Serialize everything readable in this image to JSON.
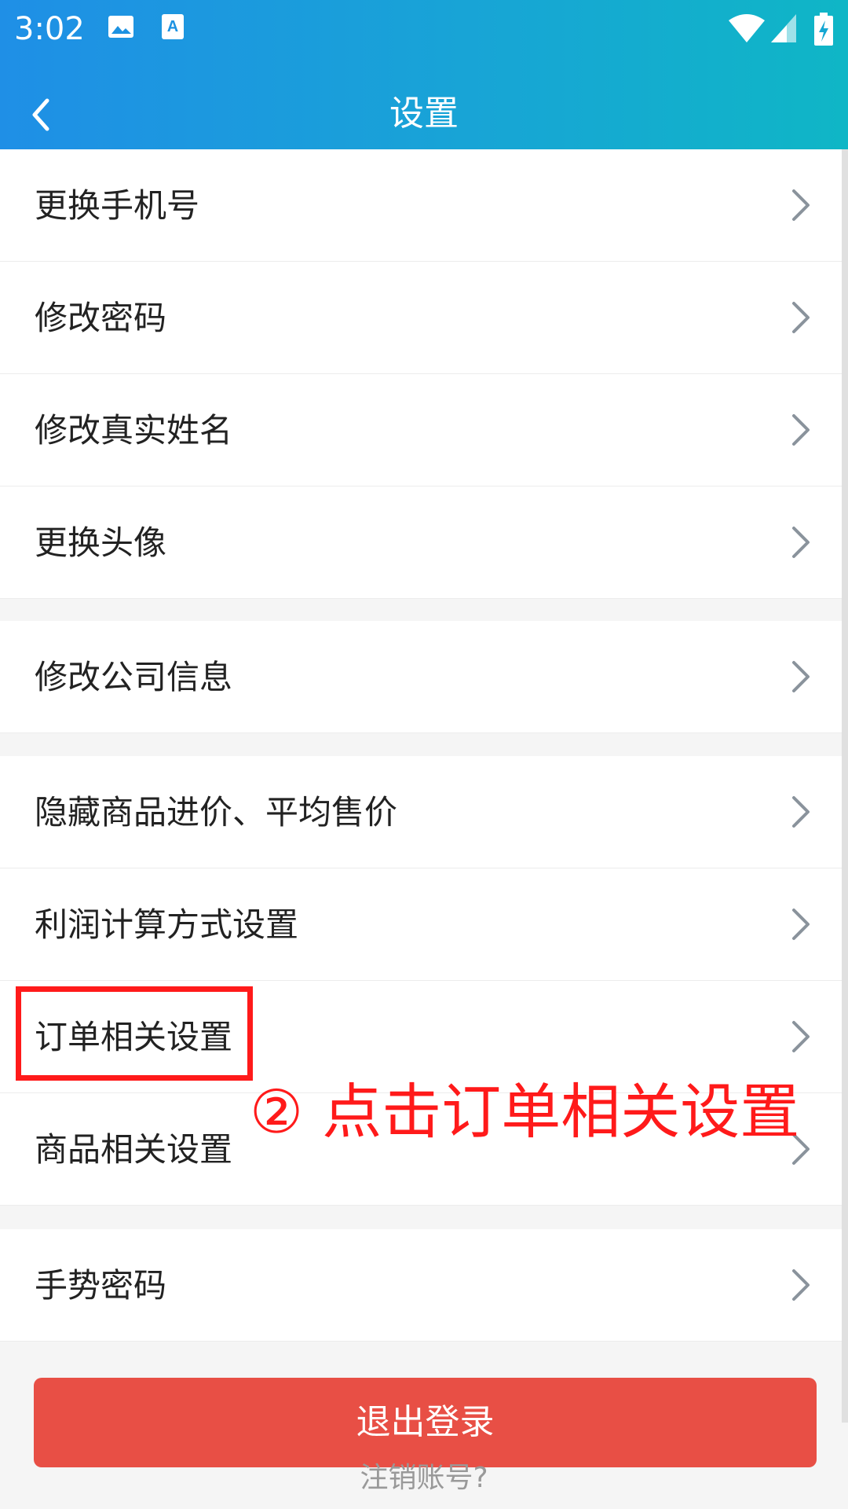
{
  "status_bar": {
    "time": "3:02",
    "icons": [
      "image-icon",
      "a-icon",
      "wifi-icon",
      "signal-icon",
      "battery-icon"
    ]
  },
  "header": {
    "title": "设置",
    "back_icon": "back-chevron-icon"
  },
  "menu": {
    "items": [
      {
        "label": "更换手机号"
      },
      {
        "label": "修改密码"
      },
      {
        "label": "修改真实姓名"
      },
      {
        "label": "更换头像"
      },
      {
        "label": "修改公司信息"
      },
      {
        "label": "隐藏商品进价、平均售价"
      },
      {
        "label": "利润计算方式设置"
      },
      {
        "label": "订单相关设置"
      },
      {
        "label": "商品相关设置"
      },
      {
        "label": "手势密码"
      }
    ]
  },
  "footer": {
    "logout_label": "退出登录",
    "cancel_account_label": "注销账号?"
  },
  "annotation": {
    "text": "② 点击订单相关设置"
  },
  "colors": {
    "header_gradient_start": "#1f8fe6",
    "header_gradient_end": "#0fb6c6",
    "logout_button": "#e84f45",
    "annotation_red": "#ff1a1a"
  }
}
